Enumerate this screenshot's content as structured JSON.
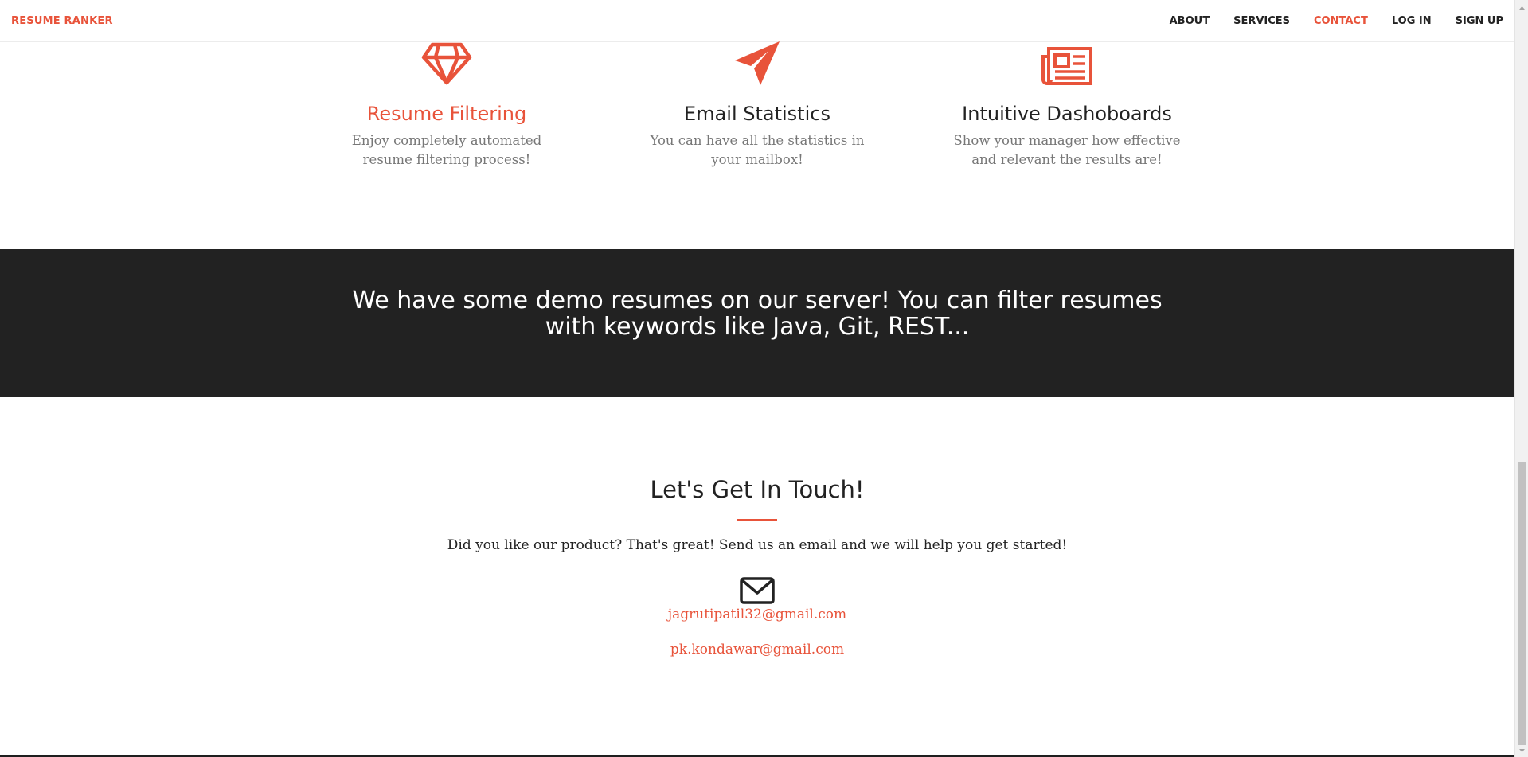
{
  "navbar": {
    "brand": "RESUME RANKER",
    "links": [
      "ABOUT",
      "SERVICES",
      "CONTACT",
      "LOG IN",
      "SIGN UP"
    ],
    "active": "CONTACT"
  },
  "services": [
    {
      "icon": "diamond-icon",
      "title": "Resume Filtering",
      "description": "Enjoy completely automated resume filtering process!"
    },
    {
      "icon": "paper-plane-icon",
      "title": "Email Statistics",
      "description": "You can have all the statistics in your mailbox!"
    },
    {
      "icon": "newspaper-icon",
      "title": "Intuitive Dashoboards",
      "description": "Show your manager how effective and relevant the results are!"
    }
  ],
  "banner": {
    "text": "We have some demo resumes on our server! You can filter resumes with keywords like Java, Git, REST..."
  },
  "contact": {
    "title": "Let's Get In Touch!",
    "text": "Did you like our product? That's great! Send us an email and we will help you get started!",
    "icon": "envelope-icon",
    "emails": [
      "jagrutipatil32@gmail.com",
      "pk.kondawar@gmail.com"
    ]
  },
  "colors": {
    "accent": "#e8533a",
    "dark": "#222222",
    "muted": "#777777"
  }
}
